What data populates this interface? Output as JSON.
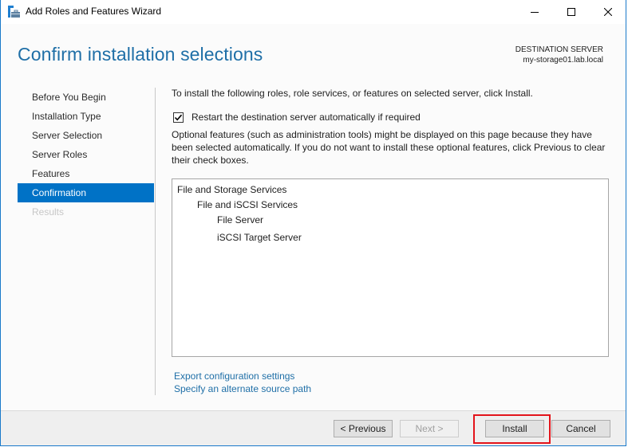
{
  "window": {
    "title": "Add Roles and Features Wizard",
    "controls": {
      "minimize": "minimize-icon",
      "maximize": "maximize-icon",
      "close": "close-icon"
    },
    "accent_color": "#1979ca"
  },
  "header": {
    "page_title": "Confirm installation selections",
    "destination_label": "DESTINATION SERVER",
    "destination_server": "my-storage01.lab.local"
  },
  "sidebar": {
    "items": [
      {
        "label": "Before You Begin",
        "state": "normal"
      },
      {
        "label": "Installation Type",
        "state": "normal"
      },
      {
        "label": "Server Selection",
        "state": "normal"
      },
      {
        "label": "Server Roles",
        "state": "normal"
      },
      {
        "label": "Features",
        "state": "normal"
      },
      {
        "label": "Confirmation",
        "state": "active"
      },
      {
        "label": "Results",
        "state": "disabled"
      }
    ],
    "active_color": "#0072c6"
  },
  "content": {
    "intro": "To install the following roles, role services, or features on selected server, click Install.",
    "restart_checkbox": {
      "label": "Restart the destination server automatically if required",
      "checked": true
    },
    "optional_note": "Optional features (such as administration tools) might be displayed on this page because they have been selected automatically. If you do not want to install these optional features, click Previous to clear their check boxes.",
    "selections": [
      {
        "label": "File and Storage Services",
        "level": 1
      },
      {
        "label": "File and iSCSI Services",
        "level": 2
      },
      {
        "label": "File Server",
        "level": 3
      },
      {
        "label": "iSCSI Target Server",
        "level": 3
      }
    ],
    "links": {
      "export": "Export configuration settings",
      "alternate_source": "Specify an alternate source path"
    }
  },
  "footer": {
    "previous": "< Previous",
    "next": "Next >",
    "install": "Install",
    "cancel": "Cancel",
    "next_enabled": false,
    "highlight_color": "#e3141b"
  }
}
